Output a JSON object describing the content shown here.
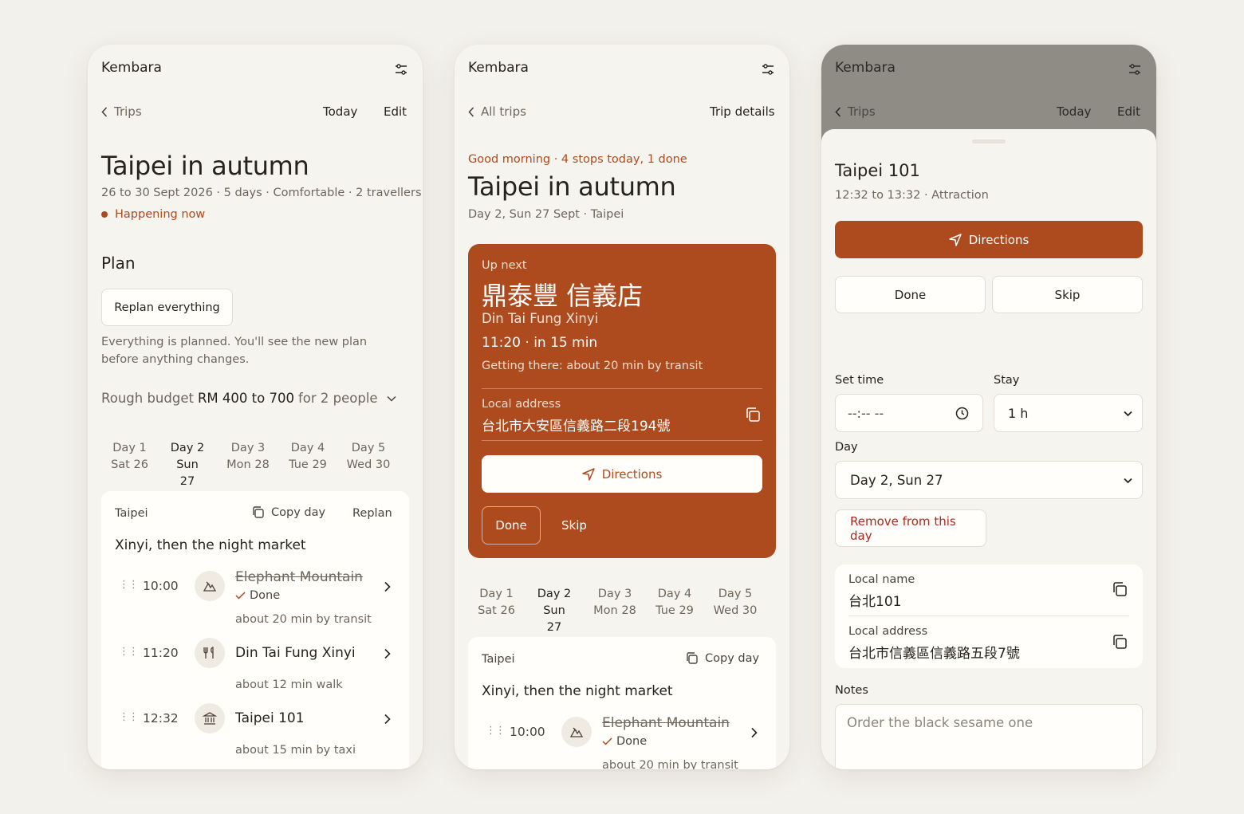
{
  "colors": {
    "accent": "#ad4b1f",
    "danger": "#b3261e",
    "background": "#f3f1eb"
  },
  "p1": {
    "brand": "Kembara",
    "back_label": "Trips",
    "today": "Today",
    "edit": "Edit",
    "title": "Taipei in autumn",
    "meta": "26 to 30 Sept 2026 · 5 days · Comfortable · 2 travellers",
    "status": "Happening now",
    "plan_heading": "Plan",
    "replan_everything": "Replan everything",
    "replan_note": "Everything is planned. You'll see the new plan before anything changes.",
    "budget_prefix": "Rough budget",
    "budget_amount": "RM 400 to 700",
    "budget_suffix": "for 2 people",
    "days": [
      {
        "day": "Day 1",
        "date": "Sat 26"
      },
      {
        "day": "Day 2",
        "date": "Sun 27"
      },
      {
        "day": "Day 3",
        "date": "Mon 28"
      },
      {
        "day": "Day 4",
        "date": "Tue 29"
      },
      {
        "day": "Day 5",
        "date": "Wed 30"
      }
    ],
    "card": {
      "city": "Taipei",
      "copy_day": "Copy day",
      "replan": "Replan",
      "heading": "Xinyi, then the night market",
      "stops": [
        {
          "time": "10:00",
          "name": "Elephant Mountain",
          "status": "Done",
          "travel": "about 20 min by transit",
          "icon": "hiking-icon"
        },
        {
          "time": "11:20",
          "name": "Din Tai Fung Xinyi",
          "travel": "about 12 min walk",
          "icon": "restaurant-icon"
        },
        {
          "time": "12:32",
          "name": "Taipei 101",
          "travel": "about 15 min by taxi",
          "icon": "landmark-icon"
        }
      ]
    }
  },
  "p2": {
    "brand": "Kembara",
    "back_label": "All trips",
    "trip_details": "Trip details",
    "greeting": "Good morning · 4 stops today, 1 done",
    "title": "Taipei in autumn",
    "day_line": "Day 2, Sun 27 Sept · Taipei",
    "upnext": {
      "label": "Up next",
      "local_name": "鼎泰豐 信義店",
      "name": "Din Tai Fung Xinyi",
      "time_line": "11:20 · in 15 min",
      "getting_there": "Getting there: about 20 min by transit",
      "address_label": "Local address",
      "address": "台北市大安區信義路二段194號",
      "directions": "Directions",
      "done": "Done",
      "skip": "Skip"
    },
    "days": [
      {
        "day": "Day 1",
        "date": "Sat 26"
      },
      {
        "day": "Day 2",
        "date": "Sun 27"
      },
      {
        "day": "Day 3",
        "date": "Mon 28"
      },
      {
        "day": "Day 4",
        "date": "Tue 29"
      },
      {
        "day": "Day 5",
        "date": "Wed 30"
      }
    ],
    "card": {
      "city": "Taipei",
      "copy_day": "Copy day",
      "heading": "Xinyi, then the night market",
      "stop": {
        "time": "10:00",
        "name": "Elephant Mountain",
        "status": "Done",
        "travel": "about 20 min by transit"
      }
    }
  },
  "p3": {
    "brand": "Kembara",
    "back_label": "Trips",
    "today": "Today",
    "edit": "Edit",
    "sheet": {
      "title": "Taipei 101",
      "meta": "12:32 to 13:32 · Attraction",
      "directions": "Directions",
      "done": "Done",
      "skip": "Skip",
      "set_time_label": "Set time",
      "time_value": "--:-- --",
      "stay_label": "Stay",
      "stay_value": "1 h",
      "day_label": "Day",
      "day_value": "Day 2, Sun 27",
      "remove": "Remove from this day",
      "local_name_label": "Local name",
      "local_name": "台北101",
      "local_address_label": "Local address",
      "local_address": "台北市信義區信義路五段7號",
      "notes_label": "Notes",
      "notes_placeholder": "Order the black sesame one"
    }
  }
}
